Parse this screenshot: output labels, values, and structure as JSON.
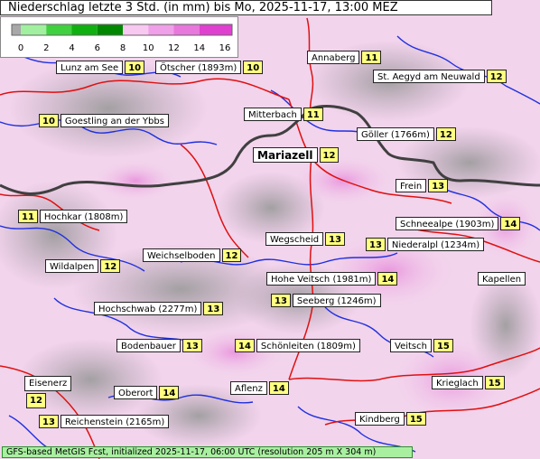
{
  "title": "Niederschlag letzte 3 Std. (in mm) bis Mo, 2025-11-17, 13:00 MEZ",
  "legend": {
    "ticks": [
      "0",
      "2",
      "4",
      "6",
      "8",
      "10",
      "12",
      "14",
      "16"
    ],
    "colors": [
      "#a8a8a8",
      "#a0f0a0",
      "#40d040",
      "#10b010",
      "#008800",
      "#f8c8f0",
      "#f0a0e8",
      "#e878dc",
      "#e040d0"
    ]
  },
  "footer": "GFS-based MetGIS Fcst, initialized 2025-11-17, 06:00 UTC  (resolution 205 m X 304 m)",
  "places": [
    {
      "name": "Lunz am See",
      "value": "10",
      "side": "left"
    },
    {
      "name": "Ötscher (1893m)",
      "value": "10",
      "side": "left"
    },
    {
      "name": "Annaberg",
      "value": "11",
      "side": "left"
    },
    {
      "name": "St. Aegyd am Neuwald",
      "value": "12",
      "side": "left"
    },
    {
      "name": "Goestling an der Ybbs",
      "value": "10",
      "side": "right"
    },
    {
      "name": "Mitterbach",
      "value": "11",
      "side": "left"
    },
    {
      "name": "Göller (1766m)",
      "value": "12",
      "side": "left"
    },
    {
      "name": "Mariazell",
      "value": "12",
      "side": "left",
      "big": true
    },
    {
      "name": "Frein",
      "value": "13",
      "side": "left"
    },
    {
      "name": "Hochkar (1808m)",
      "value": "11",
      "side": "right"
    },
    {
      "name": "Schneealpe (1903m)",
      "value": "14",
      "side": "left"
    },
    {
      "name": "Wegscheid",
      "value": "13",
      "side": "left"
    },
    {
      "name": "Niederalpl (1234m)",
      "value": "13",
      "side": "right"
    },
    {
      "name": "Weichselboden",
      "value": "12",
      "side": "left"
    },
    {
      "name": "Wildalpen",
      "value": "12",
      "side": "left"
    },
    {
      "name": "Hohe Veitsch (1981m)",
      "value": "14",
      "side": "left"
    },
    {
      "name": "Kapellen",
      "value": "",
      "side": "left"
    },
    {
      "name": "Seeberg (1246m)",
      "value": "13",
      "side": "right"
    },
    {
      "name": "Hochschwab (2277m)",
      "value": "13",
      "side": "left"
    },
    {
      "name": "Bodenbauer",
      "value": "13",
      "side": "left"
    },
    {
      "name": "Schönleiten (1809m)",
      "value": "14",
      "side": "right"
    },
    {
      "name": "Veitsch",
      "value": "15",
      "side": "left"
    },
    {
      "name": "Eisenerz",
      "value": "12",
      "side": "below"
    },
    {
      "name": "Oberort",
      "value": "14",
      "side": "left"
    },
    {
      "name": "Aflenz",
      "value": "14",
      "side": "left"
    },
    {
      "name": "Krieglach",
      "value": "15",
      "side": "left"
    },
    {
      "name": "Reichenstein (2165m)",
      "value": "13",
      "side": "right"
    },
    {
      "name": "Kindberg",
      "value": "15",
      "side": "left"
    }
  ]
}
